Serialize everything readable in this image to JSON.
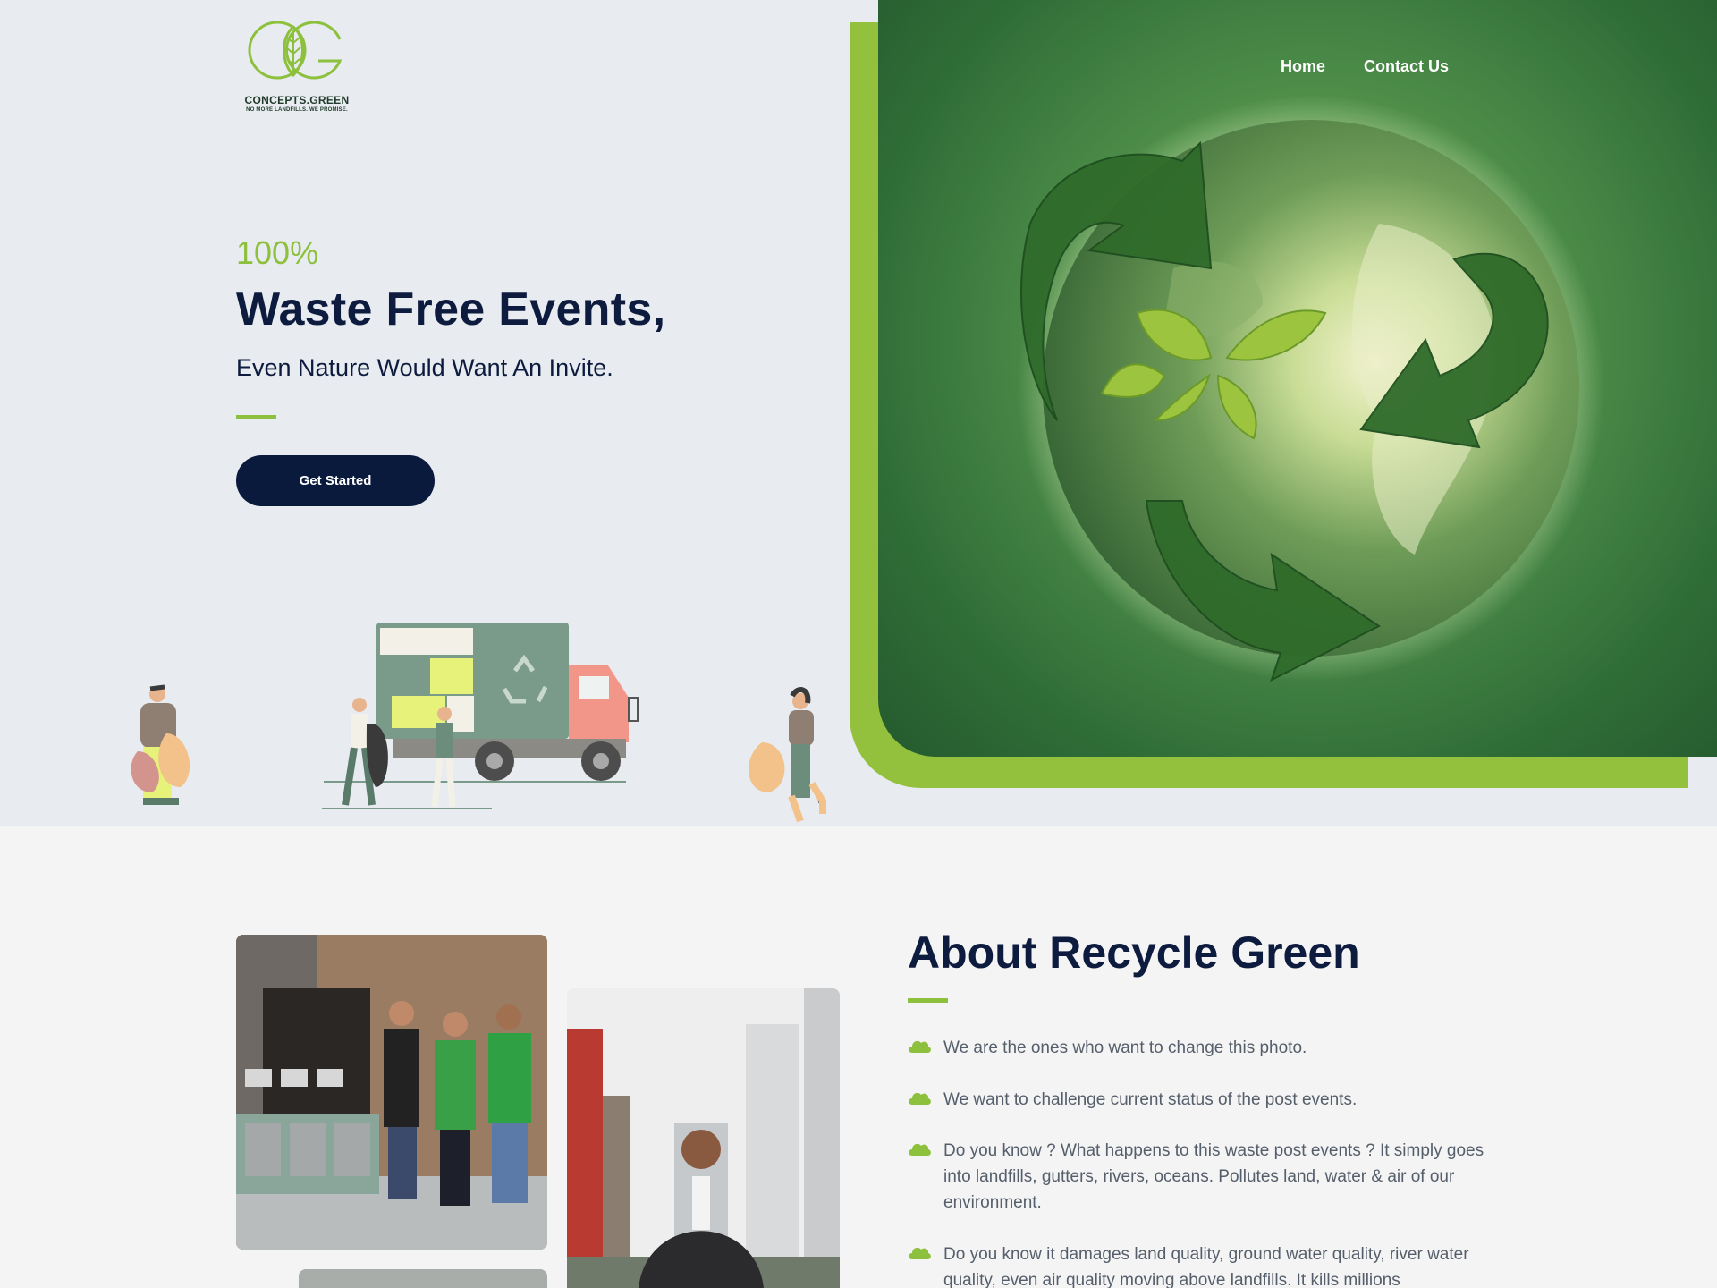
{
  "logo": {
    "name": "CONCEPTS.GREEN",
    "tagline": "NO MORE LANDFILLS. WE PROMISE."
  },
  "nav": {
    "home": "Home",
    "contact": "Contact Us"
  },
  "hero": {
    "eyebrow": "100%",
    "title": "Waste Free Events,",
    "subtitle": "Even Nature Would Want An Invite.",
    "cta": "Get Started"
  },
  "about": {
    "title": "About Recycle Green",
    "items": [
      "We are the ones who want to change this photo.",
      "We want to challenge current status of the post events.",
      "Do you know ? What happens to this waste post events ? It simply goes into landfills, gutters, rivers, oceans. Pollutes land, water & air of our environment.",
      "Do you know it damages land quality, ground water quality, river water quality, even air quality moving above landfills. It kills millions"
    ]
  },
  "colors": {
    "accent": "#8dc03d",
    "navy": "#0a1a3d",
    "hero_bg": "#e8ebef",
    "section_bg": "#f4f4f4"
  }
}
